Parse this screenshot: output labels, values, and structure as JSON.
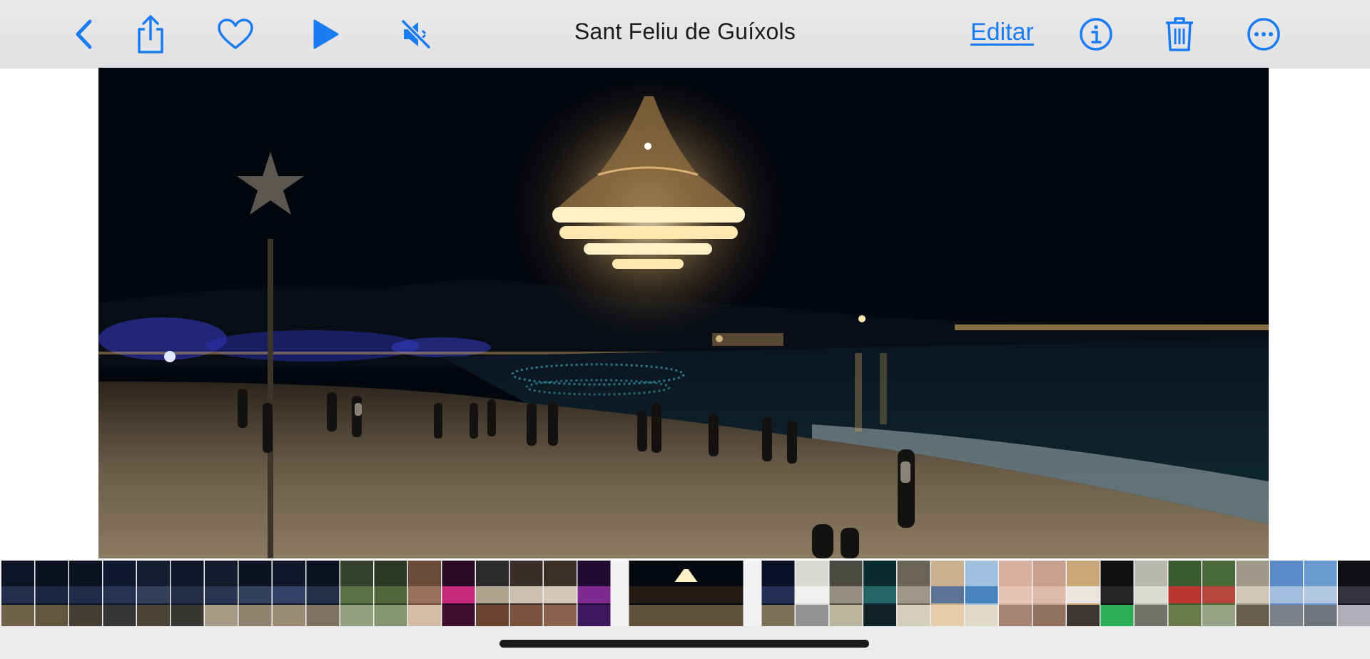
{
  "toolbar": {
    "title": "Sant Feliu de Guíxols",
    "edit_label": "Editar",
    "accent": "#1b7cf2",
    "icons": [
      "chevron-left-icon",
      "share-icon",
      "heart-icon",
      "play-icon",
      "speaker-muted-icon",
      "info-icon",
      "trash-icon",
      "more-icon"
    ]
  },
  "photo": {
    "subject": "illuminated-chandelier-over-beach-at-night"
  },
  "filmstrip": {
    "selected_index": 18,
    "thumbnails": [
      {
        "theme": "night-bay",
        "colors": [
          "#0c1426",
          "#2a3352",
          "#7a6a4a"
        ]
      },
      {
        "theme": "night-bay",
        "colors": [
          "#0a1020",
          "#1e2a48",
          "#6c5e44"
        ]
      },
      {
        "theme": "night-bay",
        "colors": [
          "#0b1222",
          "#243050",
          "#4a4638"
        ]
      },
      {
        "theme": "night-bay",
        "colors": [
          "#101830",
          "#2c3858",
          "#3a3a36"
        ]
      },
      {
        "theme": "night-bay",
        "colors": [
          "#141c30",
          "#3a4460",
          "#504838"
        ]
      },
      {
        "theme": "night-bay",
        "colors": [
          "#0e1628",
          "#28324c",
          "#3c3a34"
        ]
      },
      {
        "theme": "night-street",
        "colors": [
          "#121a2c",
          "#2e3a58",
          "#b8a890"
        ]
      },
      {
        "theme": "night-street",
        "colors": [
          "#0c1424",
          "#3a4a68",
          "#9c8e78"
        ]
      },
      {
        "theme": "night-street",
        "colors": [
          "#10182a",
          "#3a4a6e",
          "#a8987c"
        ]
      },
      {
        "theme": "night-street",
        "colors": [
          "#0a1222",
          "#2a3650",
          "#8a7c66"
        ]
      },
      {
        "theme": "garden",
        "colors": [
          "#34402c",
          "#607a48",
          "#a0a888"
        ]
      },
      {
        "theme": "garden",
        "colors": [
          "#2c3826",
          "#587040",
          "#90a078"
        ]
      },
      {
        "theme": "street-dusk",
        "colors": [
          "#6a4a38",
          "#a07860",
          "#e0c8b0"
        ]
      },
      {
        "theme": "pink-tree",
        "colors": [
          "#2a0a24",
          "#e0308a",
          "#401030"
        ]
      },
      {
        "theme": "market",
        "colors": [
          "#2a2a2a",
          "#c8b8a0",
          "#704830"
        ]
      },
      {
        "theme": "market",
        "colors": [
          "#3a2e28",
          "#e8d8c8",
          "#805840"
        ]
      },
      {
        "theme": "market",
        "colors": [
          "#3a3028",
          "#f0e0d0",
          "#906850"
        ]
      },
      {
        "theme": "purple-lights",
        "colors": [
          "#200a30",
          "#9030a0",
          "#401860"
        ]
      },
      {
        "theme": "chandelier",
        "colors": [
          "#05070f",
          "#2a2014",
          "#6a5a40"
        ]
      },
      {
        "theme": "night-beach",
        "colors": [
          "#0a1026",
          "#2a3660",
          "#8a7c60"
        ]
      },
      {
        "theme": "sign",
        "colors": [
          "#d8d8d4",
          "#f4f4f2",
          "#8a8a88"
        ]
      },
      {
        "theme": "plaza",
        "colors": [
          "#4a4a40",
          "#a09a88",
          "#c8c0a8"
        ]
      },
      {
        "theme": "teal-night",
        "colors": [
          "#0a2a30",
          "#2a7070",
          "#102024"
        ]
      },
      {
        "theme": "room",
        "colors": [
          "#6a6458",
          "#a8a090",
          "#e0d8c8"
        ]
      },
      {
        "theme": "beach-day",
        "colors": [
          "#c8b090",
          "#4a6a9a",
          "#e8d0b0"
        ]
      },
      {
        "theme": "beach-day",
        "colors": [
          "#a0c0e0",
          "#3a78b8",
          "#e8dcc4"
        ]
      },
      {
        "theme": "hands",
        "colors": [
          "#d8b0a0",
          "#e8c8b8",
          "#a08070"
        ]
      },
      {
        "theme": "hands",
        "colors": [
          "#c8a090",
          "#e0c0b0",
          "#8a6a5a"
        ]
      },
      {
        "theme": "phone",
        "colors": [
          "#c8a878",
          "#f0f0f0",
          "#2a2a2a"
        ]
      },
      {
        "theme": "phone-call",
        "colors": [
          "#101010",
          "#2a2a2a",
          "#30c060"
        ]
      },
      {
        "theme": "fence",
        "colors": [
          "#b8b8b0",
          "#e0e0d8",
          "#6a6a60"
        ]
      },
      {
        "theme": "flowers",
        "colors": [
          "#3a5a30",
          "#d03030",
          "#708050"
        ]
      },
      {
        "theme": "flowers",
        "colors": [
          "#4a6a3a",
          "#c84040",
          "#a0a890"
        ]
      },
      {
        "theme": "interior",
        "colors": [
          "#a09888",
          "#d8d0c0",
          "#605848"
        ]
      },
      {
        "theme": "street-day",
        "colors": [
          "#5a8ac8",
          "#b0c8e0",
          "#808080"
        ]
      },
      {
        "theme": "street-day",
        "colors": [
          "#6a9ad0",
          "#c0d0e0",
          "#707070"
        ]
      },
      {
        "theme": "screenshot",
        "colors": [
          "#101014",
          "#3a3a44",
          "#c0c0c8"
        ]
      }
    ]
  }
}
